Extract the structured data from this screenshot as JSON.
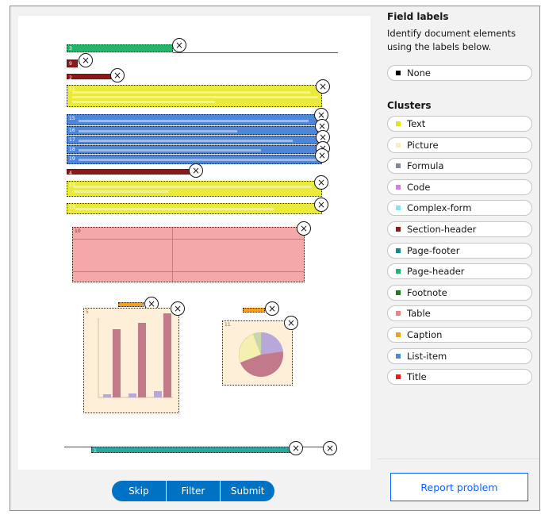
{
  "toolbar": {
    "skip": "Skip",
    "filter": "Filter",
    "submit": "Submit"
  },
  "panel": {
    "field_labels_title": "Field labels",
    "field_labels_desc": "Identify document elements using the labels below.",
    "none_label": "None",
    "none_color": "#000000",
    "clusters_title": "Clusters",
    "clusters": [
      {
        "label": "Text",
        "color": "#e5e51a"
      },
      {
        "label": "Picture",
        "color": "#fdebcc"
      },
      {
        "label": "Formula",
        "color": "#808a96"
      },
      {
        "label": "Code",
        "color": "#d07ee0"
      },
      {
        "label": "Complex-form",
        "color": "#7fe7f5"
      },
      {
        "label": "Section-header",
        "color": "#8b1a1a"
      },
      {
        "label": "Page-footer",
        "color": "#168a8a"
      },
      {
        "label": "Page-header",
        "color": "#1fb56a"
      },
      {
        "label": "Footnote",
        "color": "#1e7a1e"
      },
      {
        "label": "Table",
        "color": "#ef8080"
      },
      {
        "label": "Caption",
        "color": "#f0a020"
      },
      {
        "label": "List-item",
        "color": "#4f86d8"
      },
      {
        "label": "Title",
        "color": "#e02020"
      }
    ]
  },
  "report_button": "Report problem",
  "close_glyph": "×",
  "doc_badges": {
    "header": "3",
    "s1": "9",
    "s2": "2",
    "text1": "11",
    "list1": "15",
    "list2": "16",
    "list3": "17",
    "list4": "18",
    "list5": "19",
    "s3": "4",
    "text2": "12",
    "text3": "13",
    "table": "10",
    "fig1": "5",
    "fig2": "11",
    "footer": "1"
  }
}
